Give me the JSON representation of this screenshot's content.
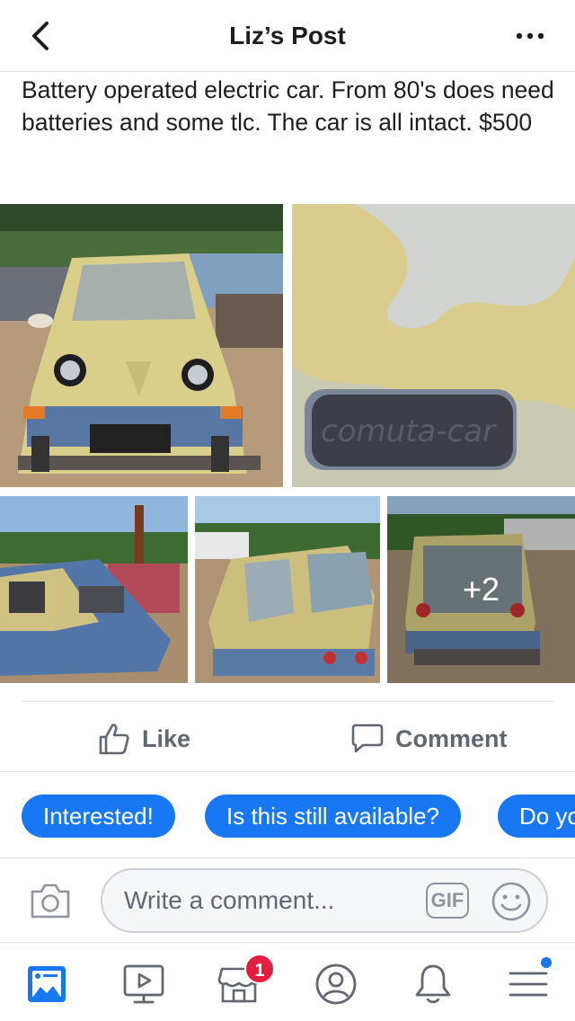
{
  "header": {
    "title": "Liz’s Post"
  },
  "post": {
    "text": "Battery operated electric car. From 80's does need batteries and some tlc. The car is all intact. $500"
  },
  "photos": {
    "badge_text": "comuta-car",
    "more_count": "+2"
  },
  "actions": {
    "like_label": "Like",
    "comment_label": "Comment"
  },
  "quick_replies": [
    {
      "label": "Interested!"
    },
    {
      "label": "Is this still available?"
    },
    {
      "label": "Do yo"
    }
  ],
  "composer": {
    "placeholder": "Write a comment...",
    "gif_label": "GIF"
  },
  "tabbar": {
    "tabs": [
      {
        "icon": "news-feed-icon",
        "active": true
      },
      {
        "icon": "watch-icon",
        "active": false
      },
      {
        "icon": "marketplace-icon",
        "active": false,
        "badge": "1"
      },
      {
        "icon": "profile-icon",
        "active": false
      },
      {
        "icon": "notifications-icon",
        "active": false
      },
      {
        "icon": "menu-icon",
        "active": false
      }
    ]
  },
  "colors": {
    "accent": "#1877f2",
    "badge": "#e41e3f",
    "text": "#1c1e21",
    "secondary_text": "#606770"
  }
}
